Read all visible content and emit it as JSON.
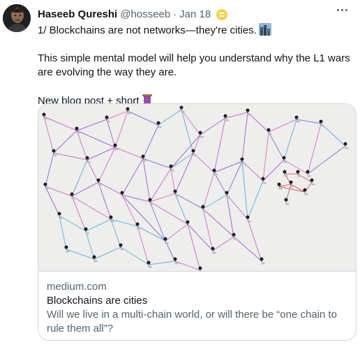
{
  "tweet": {
    "author_name": "Haseeb Qureshi",
    "author_handle": "@hosseeb",
    "separator": "·",
    "date": "Jan 18",
    "lines": [
      "1/ Blockchains are not networks—they're cities.",
      "This simple mental model will help you understand why the L1 wars are evolving the way they are.",
      "New blog post + short"
    ]
  },
  "card": {
    "domain": "medium.com",
    "title": "Blockchains are cities",
    "description": "Will we live in a multi-chain world, or will there be “one chain to rule them all”?"
  },
  "icons": {
    "avatar": "avatar-photo",
    "badge": "emoji-badge-icon",
    "more": "more-options-icon",
    "city": "cityscape-emoji",
    "thread": "thread-spool-emoji"
  },
  "colors": {
    "link_card_border": "#cfd9de",
    "secondary_text": "#536471",
    "primary_text": "#0f1419",
    "badge": "#f7d045"
  }
}
